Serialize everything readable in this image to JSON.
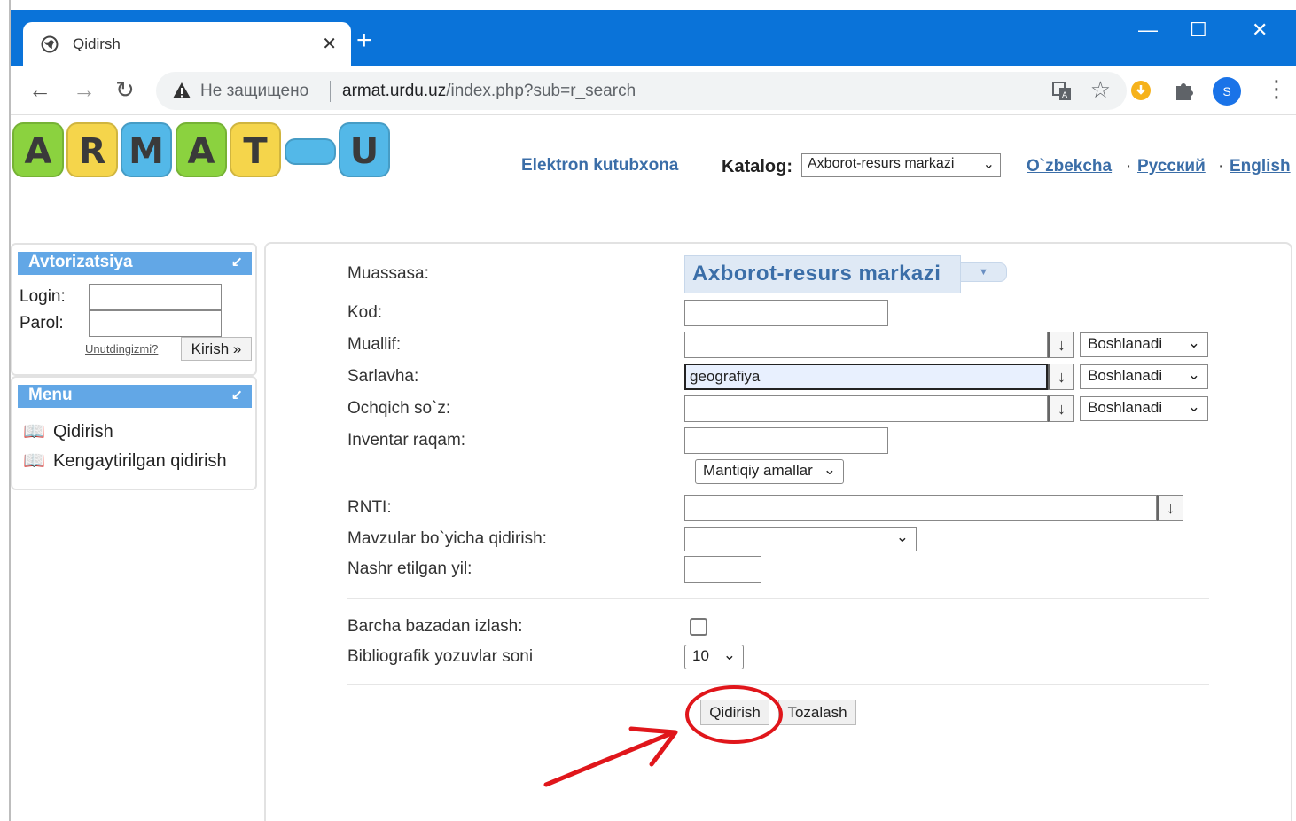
{
  "browser": {
    "tab_title": "Qidirsh",
    "insecure_label": "Не защищено",
    "url_host": "armat.urdu.uz",
    "url_path": "/index.php?sub=r_search",
    "avatar_letter": "S",
    "accent_color": "#0a73d9"
  },
  "header": {
    "logo_letters": [
      "A",
      "R",
      "M",
      "A",
      "T",
      "U"
    ],
    "site_link": "Elektron kutubxona",
    "katalog_label": "Katalog:",
    "katalog_value": "Axborot-resurs markazi",
    "languages": [
      "O`zbekcha",
      "Русский",
      "English"
    ],
    "lang_separator": "·"
  },
  "auth": {
    "title": "Avtorizatsiya",
    "login_label": "Login:",
    "password_label": "Parol:",
    "forgot_link": "Unutdingizmi?",
    "submit_label": "Kirish »"
  },
  "menu": {
    "title": "Menu",
    "items": [
      {
        "label": "Qidirish",
        "icon": "book-icon"
      },
      {
        "label": "Kengaytirilgan qidirish",
        "icon": "book-icon"
      }
    ]
  },
  "form": {
    "muassasa_label": "Muassasa:",
    "muassasa_value": "Axborot-resurs markazi",
    "kod_label": "Kod:",
    "kod_value": "",
    "muallif_label": "Muallif:",
    "muallif_value": "",
    "muallif_mode": "Boshlanadi",
    "sarlavha_label": "Sarlavha:",
    "sarlavha_value": "geografiya",
    "sarlavha_mode": "Boshlanadi",
    "ochqich_label": "Ochqich so`z:",
    "ochqich_value": "",
    "ochqich_mode": "Boshlanadi",
    "inventar_label": "Inventar raqam:",
    "inventar_value": "",
    "logic_label": "Mantiqiy amallar",
    "rnti_label": "RNTI:",
    "rnti_value": "",
    "mavzular_label": "Mavzular bo`yicha qidirish:",
    "mavzular_value": "",
    "nashr_label": "Nashr etilgan yil:",
    "nashr_value": "",
    "barcha_label": "Barcha bazadan izlash:",
    "barcha_checked": false,
    "bibliografik_label": "Bibliografik yozuvlar soni",
    "bibliografik_value": "10",
    "arrow_glyph": "↓",
    "search_button": "Qidirish",
    "clear_button": "Tozalash"
  }
}
